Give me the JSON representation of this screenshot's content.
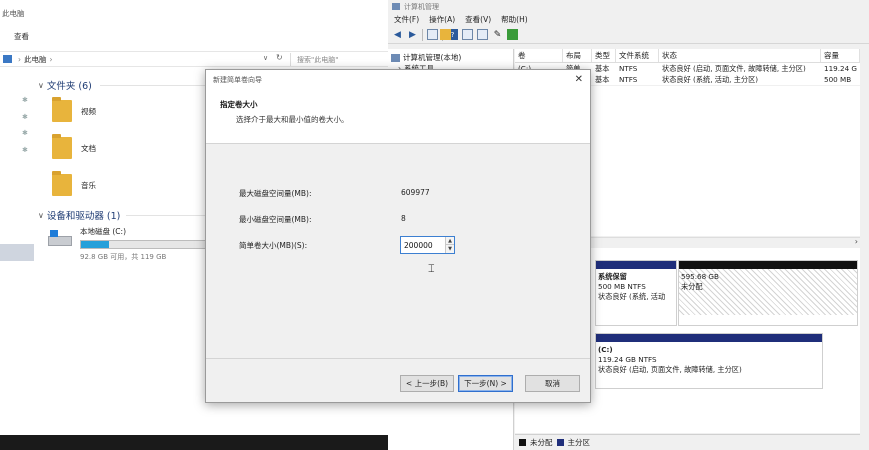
{
  "explorer": {
    "title": "此电脑",
    "ribbon_tab": "查看",
    "breadcrumb": [
      "此电脑"
    ],
    "search_placeholder": "搜索\"此电脑\"",
    "folders_header": "文件夹 (6)",
    "folders": [
      {
        "label": "视频",
        "icon": "video-folder-icon"
      },
      {
        "label": "文档",
        "icon": "documents-folder-icon"
      },
      {
        "label": "音乐",
        "icon": "music-folder-icon"
      }
    ],
    "devices_header": "设备和驱动器 (1)",
    "drive": {
      "name": "本地磁盘 (C:)",
      "free_text": "92.8 GB 可用，共 119 GB",
      "used_fraction": 0.22
    }
  },
  "mgmt": {
    "title": "计算机管理",
    "menu": [
      "文件(F)",
      "操作(A)",
      "查看(V)",
      "帮助(H)"
    ],
    "tree": [
      {
        "label": "计算机管理(本地)"
      },
      {
        "label": "系统工具"
      }
    ],
    "columns": [
      "卷",
      "布局",
      "类型",
      "文件系统",
      "状态",
      "容量"
    ],
    "rows": [
      [
        "(C:)",
        "简单",
        "基本",
        "NTFS",
        "状态良好 (启动, 页面文件, 故障转储, 主分区)",
        "119.24 G"
      ],
      [
        "",
        "简单",
        "基本",
        "NTFS",
        "状态良好 (系统, 活动, 主分区)",
        "500 MB"
      ]
    ],
    "partitions": {
      "system": {
        "name": "系统保留",
        "size": "500 MB NTFS",
        "status": "状态良好 (系统, 活动"
      },
      "unallocated": {
        "size": "595.68 GB",
        "status": "未分配"
      },
      "c_drive": {
        "name": "(C:)",
        "size": "119.24 GB NTFS",
        "status": "状态良好 (启动, 页面文件, 故障转储, 主分区)"
      }
    },
    "legend": [
      {
        "label": "未分配",
        "color": "#111111"
      },
      {
        "label": "主分区",
        "color": "#1f2e7a"
      }
    ]
  },
  "wizard": {
    "title": "新建简单卷向导",
    "heading": "指定卷大小",
    "subheading": "选择介于最大和最小值的卷大小。",
    "max_label": "最大磁盘空间量(MB):",
    "max_value": "609977",
    "min_label": "最小磁盘空间量(MB):",
    "min_value": "8",
    "size_label": "简单卷大小(MB)(S):",
    "size_value": "200000",
    "back_button": "< 上一步(B)",
    "next_button": "下一步(N) >",
    "cancel_button": "取消"
  }
}
